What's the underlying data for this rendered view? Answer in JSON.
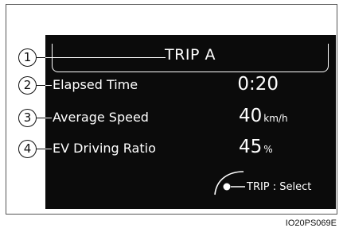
{
  "display": {
    "title": "TRIP A",
    "rows": [
      {
        "callout": "2",
        "label": "Elapsed Time",
        "value": "0:20",
        "unit": ""
      },
      {
        "callout": "3",
        "label": "Average Speed",
        "value": "40",
        "unit": "km/h"
      },
      {
        "callout": "4",
        "label": "EV Driving Ratio",
        "value": "45",
        "unit": "%"
      }
    ],
    "title_callout": "1",
    "select_hint": "TRIP : Select"
  },
  "figure_code": "IO20PS069E",
  "colors": {
    "screen_bg": "#0b0b0b",
    "text": "#ffffff",
    "callout_border": "#111111"
  },
  "icons": [
    "steering-switch-icon"
  ]
}
